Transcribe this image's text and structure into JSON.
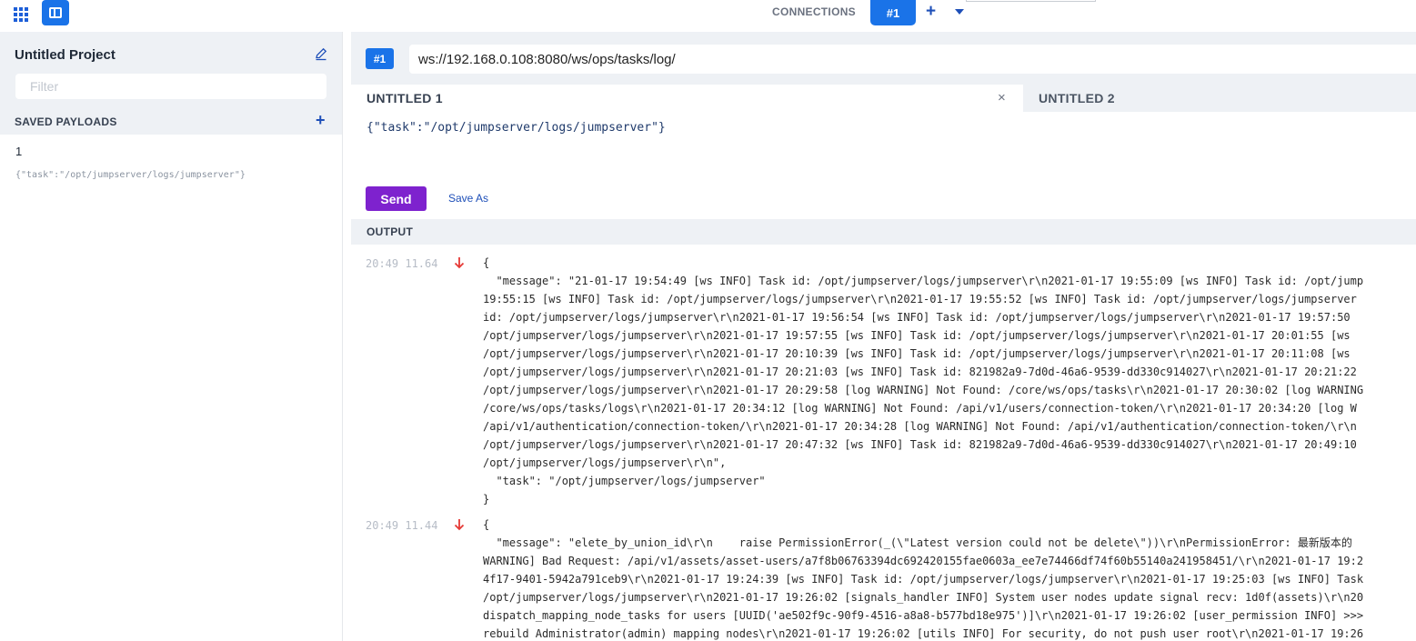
{
  "topbar": {
    "connections_label": "CONNECTIONS",
    "active_connection": "#1"
  },
  "sidebar": {
    "project_title": "Untitled Project",
    "filter_placeholder": "Filter",
    "saved_payloads_label": "SAVED PAYLOADS",
    "payloads": [
      {
        "name": "1",
        "preview": "{\"task\":\"/opt/jumpserver/logs/jumpserver\"}"
      }
    ]
  },
  "main": {
    "connection_badge": "#1",
    "url": "ws://192.168.0.108:8080/ws/ops/tasks/log/",
    "tabs": [
      {
        "label": "UNTITLED 1",
        "active": true
      },
      {
        "label": "UNTITLED 2",
        "active": false
      }
    ],
    "editor_content": "{\"task\":\"/opt/jumpserver/logs/jumpserver\"}",
    "send_label": "Send",
    "save_as_label": "Save As",
    "output_label": "OUTPUT",
    "messages": [
      {
        "time": "20:49 11.64",
        "direction": "incoming",
        "lines": [
          "{",
          "  \"message\": \"21-01-17 19:54:49 [ws INFO] Task id: /opt/jumpserver/logs/jumpserver\\r\\n2021-01-17 19:55:09 [ws INFO] Task id: /opt/jump",
          "19:55:15 [ws INFO] Task id: /opt/jumpserver/logs/jumpserver\\r\\n2021-01-17 19:55:52 [ws INFO] Task id: /opt/jumpserver/logs/jumpserver",
          "id: /opt/jumpserver/logs/jumpserver\\r\\n2021-01-17 19:56:54 [ws INFO] Task id: /opt/jumpserver/logs/jumpserver\\r\\n2021-01-17 19:57:50",
          "/opt/jumpserver/logs/jumpserver\\r\\n2021-01-17 19:57:55 [ws INFO] Task id: /opt/jumpserver/logs/jumpserver\\r\\n2021-01-17 20:01:55 [ws",
          "/opt/jumpserver/logs/jumpserver\\r\\n2021-01-17 20:10:39 [ws INFO] Task id: /opt/jumpserver/logs/jumpserver\\r\\n2021-01-17 20:11:08 [ws",
          "/opt/jumpserver/logs/jumpserver\\r\\n2021-01-17 20:21:03 [ws INFO] Task id: 821982a9-7d0d-46a6-9539-dd330c914027\\r\\n2021-01-17 20:21:22",
          "/opt/jumpserver/logs/jumpserver\\r\\n2021-01-17 20:29:58 [log WARNING] Not Found: /core/ws/ops/tasks\\r\\n2021-01-17 20:30:02 [log WARNING",
          "/core/ws/ops/tasks/logs\\r\\n2021-01-17 20:34:12 [log WARNING] Not Found: /api/v1/users/connection-token/\\r\\n2021-01-17 20:34:20 [log W",
          "/api/v1/authentication/connection-token/\\r\\n2021-01-17 20:34:28 [log WARNING] Not Found: /api/v1/authentication/connection-token/\\r\\n",
          "/opt/jumpserver/logs/jumpserver\\r\\n2021-01-17 20:47:32 [ws INFO] Task id: 821982a9-7d0d-46a6-9539-dd330c914027\\r\\n2021-01-17 20:49:10",
          "/opt/jumpserver/logs/jumpserver\\r\\n\",",
          "  \"task\": \"/opt/jumpserver/logs/jumpserver\"",
          "}"
        ]
      },
      {
        "time": "20:49 11.44",
        "direction": "incoming",
        "lines": [
          "{",
          "  \"message\": \"elete_by_union_id\\r\\n    raise PermissionError(_(\\\"Latest version could not be delete\\\"))\\r\\nPermissionError: 最新版本的",
          "WARNING] Bad Request: /api/v1/assets/asset-users/a7f8b06763394dc692420155fae0603a_ee7e74466df74f60b55140a241958451/\\r\\n2021-01-17 19:2",
          "4f17-9401-5942a791ceb9\\r\\n2021-01-17 19:24:39 [ws INFO] Task id: /opt/jumpserver/logs/jumpserver\\r\\n2021-01-17 19:25:03 [ws INFO] Task",
          "/opt/jumpserver/logs/jumpserver\\r\\n2021-01-17 19:26:02 [signals_handler INFO] System user nodes update signal recv: 1d0f(assets)\\r\\n20",
          "dispatch_mapping_node_tasks for users [UUID('ae502f9c-90f9-4516-a8a8-b577bd18e975')]\\r\\n2021-01-17 19:26:02 [user_permission INFO] >>>",
          "rebuild Administrator(admin) mapping nodes\\r\\n2021-01-17 19:26:02 [utils INFO] For security, do not push user root\\r\\n2021-01-17 19:26"
        ]
      }
    ]
  },
  "colors": {
    "accent": "#1a73e8",
    "send": "#7e22ce",
    "panel_bg": "#eef1f5",
    "incoming_arrow": "#e53935"
  }
}
